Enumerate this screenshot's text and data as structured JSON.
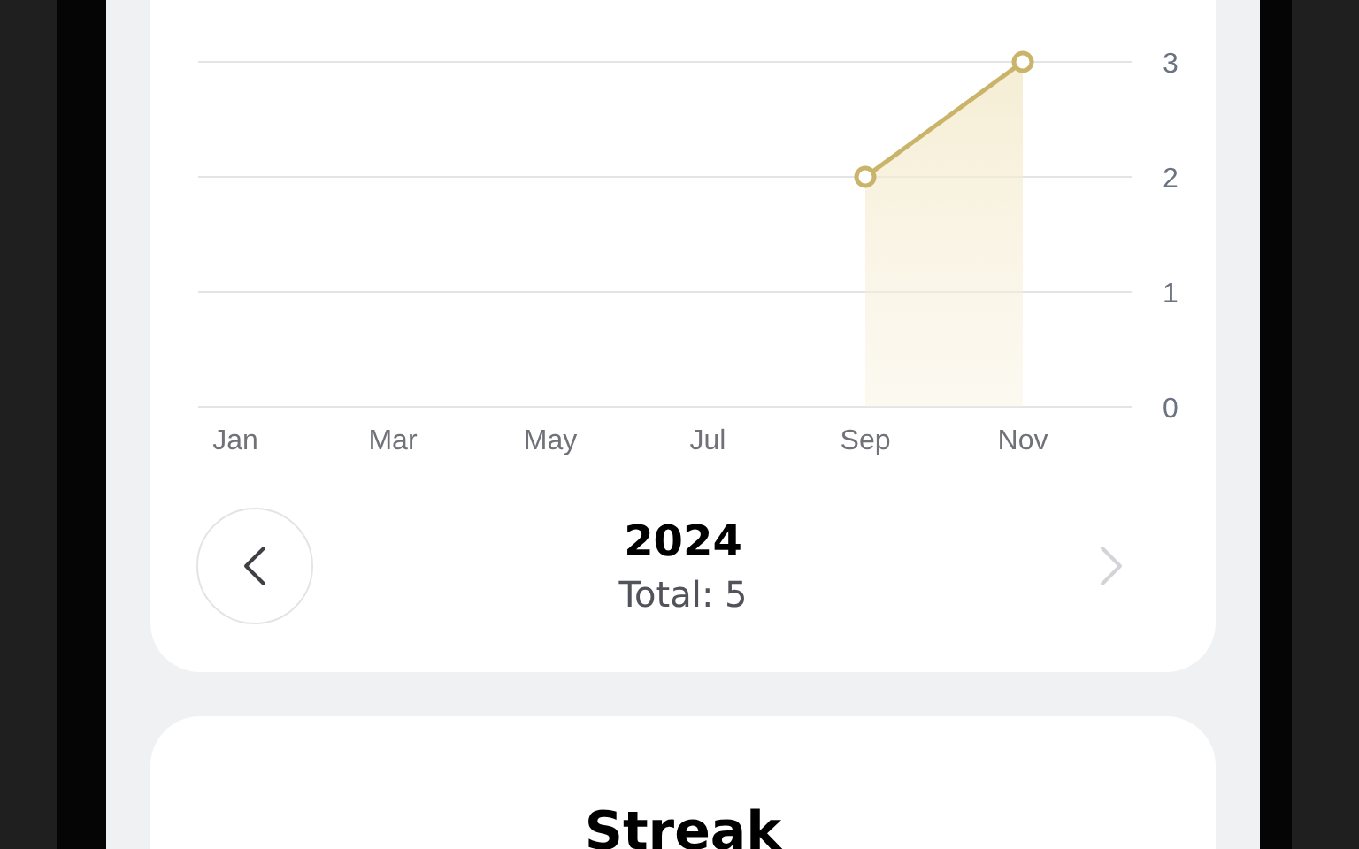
{
  "chart": {
    "chart_data": {
      "type": "area",
      "categories": [
        "Jan",
        "Mar",
        "May",
        "Jul",
        "Sep",
        "Nov"
      ],
      "series": [
        {
          "color": "#c9b46a",
          "values": [
            null,
            null,
            null,
            null,
            2,
            3
          ]
        }
      ],
      "ylim": [
        0,
        3
      ],
      "yticks": [
        0,
        1,
        2,
        3
      ]
    }
  },
  "year_nav": {
    "prev_disabled": false,
    "next_disabled": true,
    "year": "2024",
    "total": "Total: 5"
  },
  "streak_card": {
    "title": "Streak"
  }
}
